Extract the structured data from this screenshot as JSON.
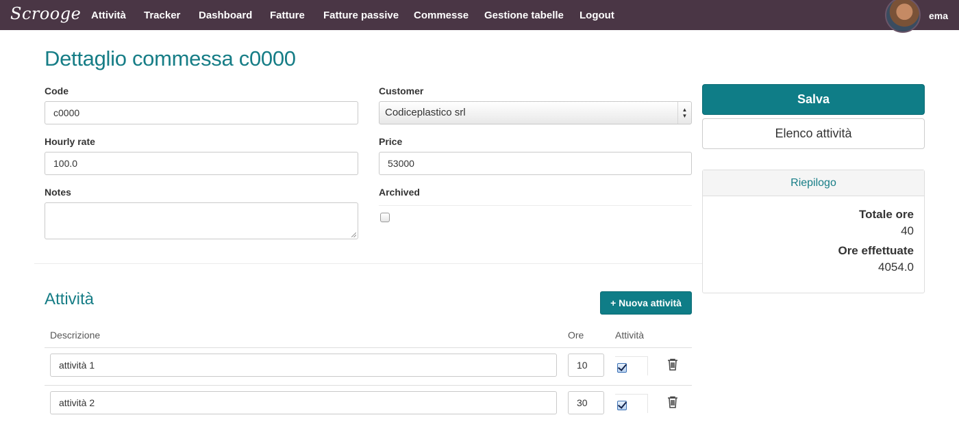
{
  "navbar": {
    "brand": "Scrooge",
    "items": [
      "Attività",
      "Tracker",
      "Dashboard",
      "Fatture",
      "Fatture passive",
      "Commesse",
      "Gestione tabelle",
      "Logout"
    ],
    "user": "ema",
    "background_color": "#4a3645"
  },
  "page": {
    "title": "Dettaglio commessa c0000",
    "accent_color": "#167d86"
  },
  "form": {
    "code_label": "Code",
    "code_value": "c0000",
    "customer_label": "Customer",
    "customer_value": "Codiceplastico srl",
    "hourly_rate_label": "Hourly rate",
    "hourly_rate_value": "100.0",
    "price_label": "Price",
    "price_value": "53000",
    "notes_label": "Notes",
    "notes_value": "",
    "archived_label": "Archived",
    "archived_checked": false
  },
  "actions": {
    "save_label": "Salva",
    "activity_list_label": "Elenco attività"
  },
  "summary": {
    "heading": "Riepilogo",
    "total_hours_label": "Totale ore",
    "total_hours_value": "40",
    "hours_done_label": "Ore effettuate",
    "hours_done_value": "4054.0"
  },
  "activities": {
    "title": "Attività",
    "new_button_label": "+ Nuova attività",
    "columns": [
      "Descrizione",
      "Ore",
      "Attività"
    ],
    "rows": [
      {
        "description": "attività 1",
        "hours": "10",
        "active": true
      },
      {
        "description": "attività 2",
        "hours": "30",
        "active": true
      }
    ]
  }
}
